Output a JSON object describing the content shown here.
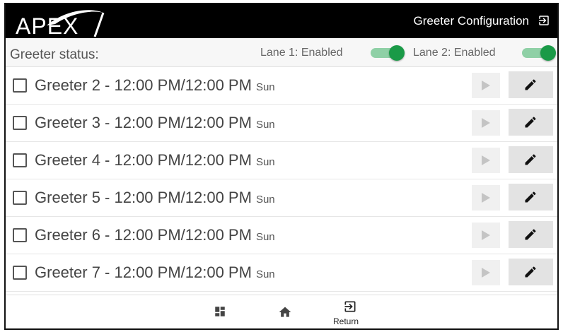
{
  "header": {
    "logo_text": "APEX",
    "title": "Greeter Configuration",
    "exit_icon": "exit-to-app-icon"
  },
  "status": {
    "label": "Greeter status:",
    "lanes": [
      {
        "label": "Lane 1: Enabled",
        "enabled": true
      },
      {
        "label": "Lane 2: Enabled",
        "enabled": true
      }
    ]
  },
  "greeters": [
    {
      "name": "Greeter 2 - 12:00 PM/12:00 PM",
      "day": "Sun",
      "checked": false
    },
    {
      "name": "Greeter 3 - 12:00 PM/12:00 PM",
      "day": "Sun",
      "checked": false
    },
    {
      "name": "Greeter 4 - 12:00 PM/12:00 PM",
      "day": "Sun",
      "checked": false
    },
    {
      "name": "Greeter 5 - 12:00 PM/12:00 PM",
      "day": "Sun",
      "checked": false
    },
    {
      "name": "Greeter 6 - 12:00 PM/12:00 PM",
      "day": "Sun",
      "checked": false
    },
    {
      "name": "Greeter 7 - 12:00 PM/12:00 PM",
      "day": "Sun",
      "checked": false
    },
    {
      "name": "",
      "day": "",
      "checked": false
    }
  ],
  "icons": {
    "play": "play-icon",
    "edit": "pencil-icon",
    "dashboard": "dashboard-icon",
    "home": "home-icon",
    "return": "exit-to-app-icon"
  },
  "nav": {
    "return_label": "Return"
  },
  "colors": {
    "toggle_knob": "#1a9a47",
    "toggle_track": "#8fd0a6",
    "topbar": "#000000"
  }
}
